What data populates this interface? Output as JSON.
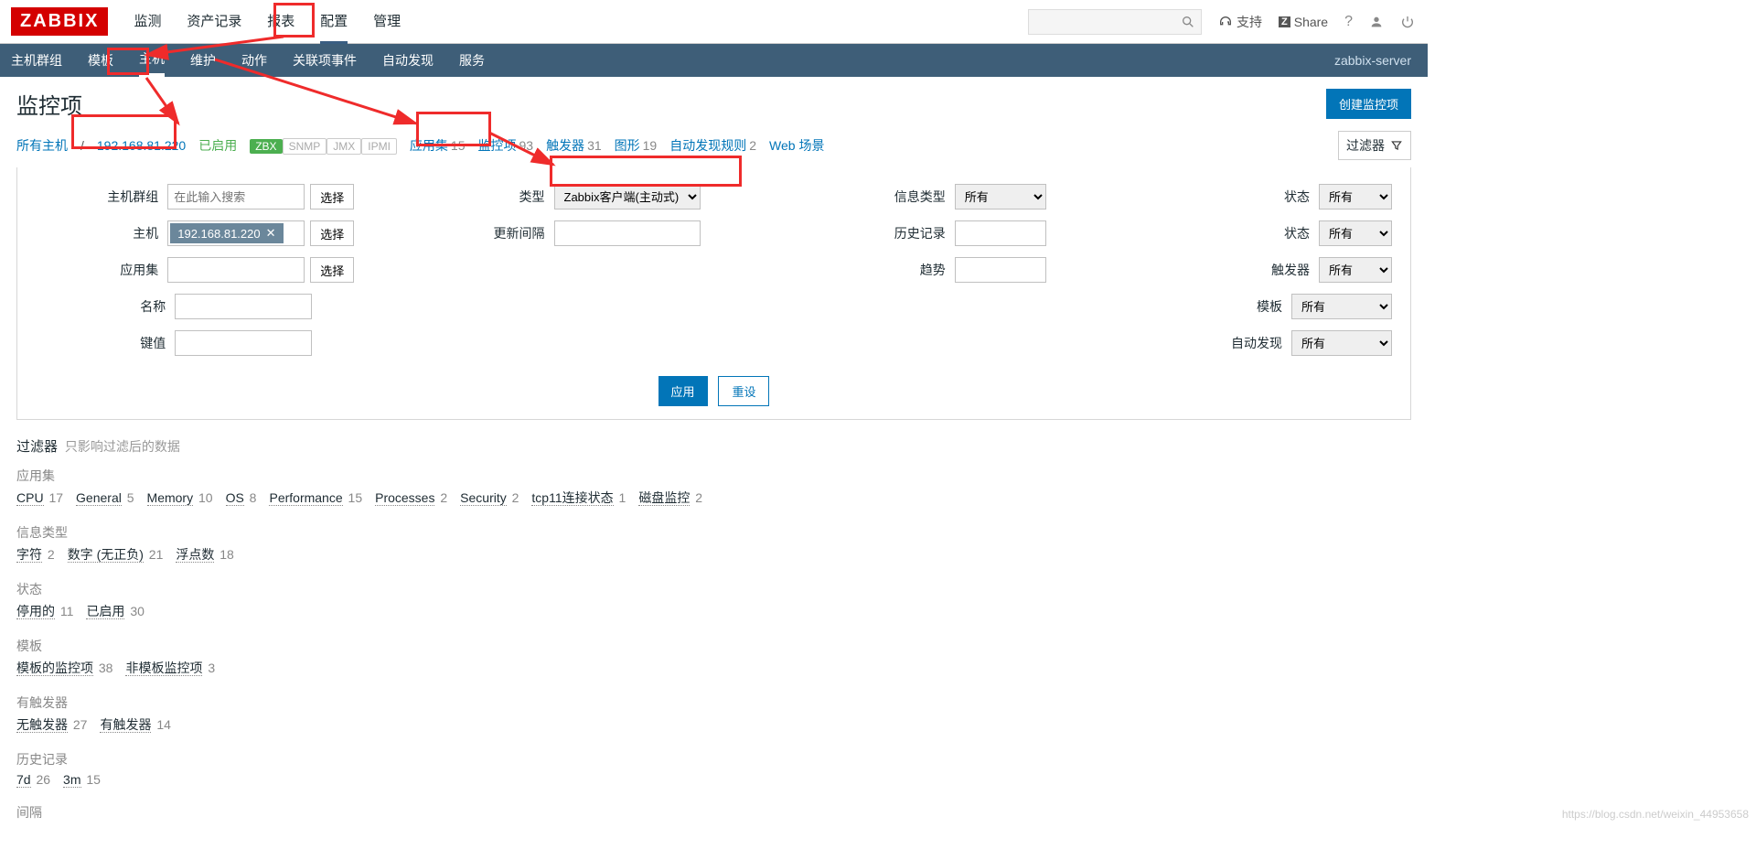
{
  "logo": "ZABBIX",
  "topnav": [
    "监测",
    "资产记录",
    "报表",
    "配置",
    "管理"
  ],
  "subnav": [
    "主机群组",
    "模板",
    "主机",
    "维护",
    "动作",
    "关联项事件",
    "自动发现",
    "服务"
  ],
  "server": "zabbix-server",
  "support": "支持",
  "share": "Share",
  "pageTitle": "监控项",
  "createBtn": "创建监控项",
  "filterBtn": "过滤器",
  "crumb": {
    "allHosts": "所有主机",
    "host": "192.168.81.220",
    "enabled": "已启用",
    "zbx": "ZBX",
    "snmp": "SNMP",
    "jmx": "JMX",
    "ipmi": "IPMI",
    "appset": "应用集",
    "appsetCnt": "15",
    "items": "监控项",
    "itemsCnt": "93",
    "triggers": "触发器",
    "triggersCnt": "31",
    "graphs": "图形",
    "graphsCnt": "19",
    "discovery": "自动发现规则",
    "discoveryCnt": "2",
    "web": "Web 场景"
  },
  "form": {
    "hostGroup": "主机群组",
    "hostGroupPh": "在此输入搜索",
    "select": "选择",
    "host": "主机",
    "hostTag": "192.168.81.220",
    "appset": "应用集",
    "name": "名称",
    "key": "键值",
    "type": "类型",
    "typeVal": "Zabbix客户端(主动式)",
    "interval": "更新间隔",
    "history": "历史记录",
    "trend": "趋势",
    "infoType": "信息类型",
    "state": "状态",
    "status": "状态",
    "triggers": "触发器",
    "template": "模板",
    "discovery": "自动发现",
    "all": "所有",
    "apply": "应用",
    "reset": "重设"
  },
  "sub": {
    "title": "过滤器",
    "hint": "只影响过滤后的数据",
    "g1": {
      "hdr": "应用集",
      "items": [
        [
          "CPU",
          "17"
        ],
        [
          "General",
          "5"
        ],
        [
          "Memory",
          "10"
        ],
        [
          "OS",
          "8"
        ],
        [
          "Performance",
          "15"
        ],
        [
          "Processes",
          "2"
        ],
        [
          "Security",
          "2"
        ],
        [
          "tcp11连接状态",
          "1"
        ],
        [
          "磁盘监控",
          "2"
        ]
      ]
    },
    "g2": {
      "hdr": "信息类型",
      "items": [
        [
          "字符",
          "2"
        ],
        [
          "数字 (无正负)",
          "21"
        ],
        [
          "浮点数",
          "18"
        ]
      ]
    },
    "g3": {
      "hdr": "状态",
      "items": [
        [
          "停用的",
          "11"
        ],
        [
          "已启用",
          "30"
        ]
      ]
    },
    "g4": {
      "hdr": "模板",
      "items": [
        [
          "模板的监控项",
          "38"
        ],
        [
          "非模板监控项",
          "3"
        ]
      ]
    },
    "g5": {
      "hdr": "有触发器",
      "items": [
        [
          "无触发器",
          "27"
        ],
        [
          "有触发器",
          "14"
        ]
      ]
    },
    "g6": {
      "hdr": "历史记录",
      "items": [
        [
          "7d",
          "26"
        ],
        [
          "3m",
          "15"
        ]
      ]
    },
    "g7": {
      "hdr": "间隔"
    }
  },
  "watermark": "https://blog.csdn.net/weixin_44953658"
}
